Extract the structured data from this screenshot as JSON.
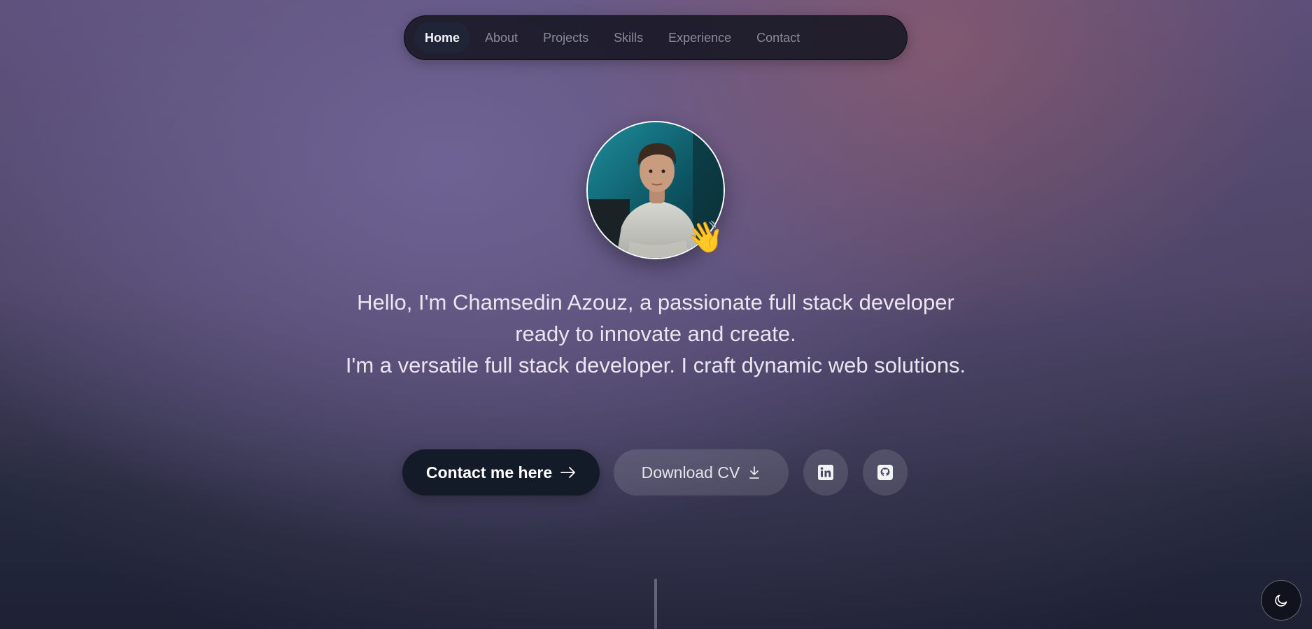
{
  "nav": {
    "items": [
      {
        "label": "Home",
        "active": true
      },
      {
        "label": "About",
        "active": false
      },
      {
        "label": "Projects",
        "active": false
      },
      {
        "label": "Skills",
        "active": false
      },
      {
        "label": "Experience",
        "active": false
      },
      {
        "label": "Contact",
        "active": false
      }
    ]
  },
  "hero": {
    "wave_emoji": "👋",
    "intro_line1": "Hello, I'm Chamsedin Azouz, a passionate full stack developer",
    "intro_line2": "ready to innovate and create.",
    "intro_line3": "I'm a versatile full stack developer. I craft dynamic web solutions."
  },
  "actions": {
    "contact_label": "Contact me here",
    "contact_icon": "arrow-right-icon",
    "cv_label": "Download CV",
    "cv_icon": "download-icon",
    "linkedin_icon": "linkedin-icon",
    "github_icon": "github-icon"
  },
  "theme_toggle": {
    "icon": "moon-icon"
  },
  "colors": {
    "nav_bg": "#161622",
    "nav_active_bg": "#1f2536",
    "primary_button": "#131a28",
    "text_light": "#e9e6ef"
  }
}
